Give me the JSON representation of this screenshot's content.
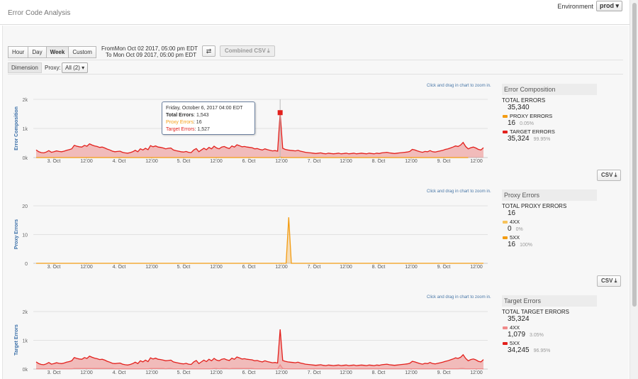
{
  "page": {
    "title": "Error Code Analysis",
    "environment_label": "Environment",
    "environment_value": "prod"
  },
  "toolbar": {
    "ranges": [
      "Hour",
      "Day",
      "Week",
      "Custom"
    ],
    "active_range": "Week",
    "from_label": "From",
    "from_value": "Mon Oct 02 2017, 05:00 pm EDT",
    "to_label": "To",
    "to_value": "Mon Oct 09 2017, 05:00 pm EDT",
    "swap_icon": "swap-arrows-icon",
    "combined_csv_label": "Combined CSV",
    "download_icon": "download-icon"
  },
  "dimension": {
    "label": "Dimension",
    "proxy_label": "Proxy:",
    "proxy_value": "All (2)"
  },
  "zoom_hint": "Click and drag in chart to zoom in.",
  "csv_label": "CSV",
  "tooltip": {
    "date": "Friday, October 6, 2017 04:00 EDT",
    "total_label": "Total Errors",
    "total_value": "1,543",
    "proxy_label": "Proxy Errors",
    "proxy_value": "16",
    "target_label": "Target Errors",
    "target_value": "1,527"
  },
  "legends": {
    "composition": {
      "title": "Error Composition",
      "total_label": "TOTAL ERRORS",
      "total_value": "35,340",
      "rows": [
        {
          "label": "PROXY ERRORS",
          "value": "16",
          "pct": "0.05%",
          "color": "#f39c12"
        },
        {
          "label": "TARGET ERRORS",
          "value": "35,324",
          "pct": "99.95%",
          "color": "#e3201c"
        }
      ]
    },
    "proxy": {
      "title": "Proxy Errors",
      "total_label": "TOTAL PROXY ERRORS",
      "total_value": "16",
      "rows": [
        {
          "label": "4XX",
          "value": "0",
          "pct": "0%",
          "color": "#f7c35a"
        },
        {
          "label": "5XX",
          "value": "16",
          "pct": "100%",
          "color": "#f39c12"
        }
      ]
    },
    "target": {
      "title": "Target Errors",
      "total_label": "TOTAL TARGET ERRORS",
      "total_value": "35,324",
      "rows": [
        {
          "label": "4XX",
          "value": "1,079",
          "pct": "3.05%",
          "color": "#f08a8a"
        },
        {
          "label": "5XX",
          "value": "34,245",
          "pct": "96.95%",
          "color": "#e3201c"
        }
      ]
    }
  },
  "chart_data": [
    {
      "type": "area",
      "title": "",
      "ylabel": "Error Composition",
      "x_ticks": [
        "3. Oct",
        "12:00",
        "4. Oct",
        "12:00",
        "5. Oct",
        "12:00",
        "6. Oct",
        "12:00",
        "7. Oct",
        "12:00",
        "8. Oct",
        "12:00",
        "9. Oct",
        "12:00"
      ],
      "y_ticks": [
        "0k",
        "1k",
        "2k"
      ],
      "ylim": [
        0,
        2000
      ],
      "x_start": "2017-10-02 17:00",
      "x_end": "2017-10-09 17:00",
      "interval_hours": 1,
      "series": [
        {
          "name": "Target Errors",
          "color": "#e3201c",
          "values": [
            260,
            200,
            170,
            160,
            190,
            240,
            180,
            200,
            230,
            210,
            200,
            220,
            250,
            270,
            300,
            420,
            390,
            370,
            360,
            420,
            390,
            470,
            430,
            400,
            380,
            350,
            360,
            330,
            290,
            260,
            220,
            200,
            210,
            220,
            180,
            160,
            150,
            170,
            200,
            250,
            200,
            300,
            260,
            320,
            270,
            410,
            370,
            400,
            360,
            350,
            330,
            300,
            320,
            330,
            260,
            240,
            220,
            200,
            190,
            210,
            180,
            170,
            260,
            310,
            200,
            260,
            320,
            270,
            350,
            300,
            390,
            330,
            300,
            360,
            380,
            340,
            310,
            400,
            360,
            440,
            410,
            370,
            380,
            360,
            350,
            340,
            300,
            310,
            280,
            260,
            300,
            270,
            250,
            230,
            240,
            220,
            1527,
            320,
            280,
            260,
            250,
            240,
            230,
            250,
            220,
            200,
            180,
            170,
            160,
            150,
            140,
            150,
            160,
            140,
            130,
            150,
            140,
            130,
            140,
            150,
            130,
            140,
            150,
            130,
            140,
            150,
            130,
            140,
            150,
            140,
            130,
            150,
            140,
            130,
            150,
            140,
            160,
            170,
            180,
            160,
            150,
            140,
            150,
            160,
            170,
            180,
            190,
            210,
            280,
            260,
            230,
            200,
            180,
            210,
            200,
            240,
            200,
            190,
            210,
            230,
            250,
            280,
            300,
            330,
            360,
            400,
            380,
            430,
            520,
            380,
            300,
            340,
            360,
            330,
            280,
            260,
            340
          ]
        },
        {
          "name": "Proxy Errors",
          "color": "#f39c12",
          "values": [
            0,
            0,
            0,
            0,
            0,
            0,
            0,
            0,
            0,
            0,
            0,
            0,
            0,
            0,
            0,
            0,
            0,
            0,
            0,
            0,
            0,
            0,
            0,
            0,
            0,
            0,
            0,
            0,
            0,
            0,
            0,
            0,
            0,
            0,
            0,
            0,
            0,
            0,
            0,
            0,
            0,
            0,
            0,
            0,
            0,
            0,
            0,
            0,
            0,
            0,
            0,
            0,
            0,
            0,
            0,
            0,
            0,
            0,
            0,
            0,
            0,
            0,
            0,
            0,
            0,
            0,
            0,
            0,
            0,
            0,
            0,
            0,
            0,
            0,
            0,
            0,
            0,
            0,
            0,
            0,
            0,
            0,
            0,
            0,
            0,
            0,
            0,
            0,
            0,
            0,
            0,
            0,
            0,
            0,
            0,
            0,
            16,
            0,
            0,
            0,
            0,
            0,
            0,
            0,
            0,
            0,
            0,
            0,
            0,
            0,
            0,
            0,
            0,
            0,
            0,
            0,
            0,
            0,
            0,
            0,
            0,
            0,
            0,
            0,
            0,
            0,
            0,
            0,
            0,
            0,
            0,
            0,
            0,
            0,
            0,
            0,
            0,
            0,
            0,
            0,
            0,
            0,
            0,
            0,
            0,
            0,
            0,
            0,
            0,
            0,
            0,
            0,
            0,
            0,
            0,
            0,
            0,
            0,
            0,
            0,
            0,
            0,
            0,
            0,
            0,
            0,
            0,
            0,
            0,
            0,
            0
          ]
        }
      ]
    },
    {
      "type": "area",
      "title": "",
      "ylabel": "Proxy Errors",
      "x_ticks": [
        "3. Oct",
        "12:00",
        "4. Oct",
        "12:00",
        "5. Oct",
        "12:00",
        "6. Oct",
        "12:00",
        "7. Oct",
        "12:00",
        "8. Oct",
        "12:00",
        "9. Oct",
        "12:00"
      ],
      "y_ticks": [
        "0",
        "10",
        "20"
      ],
      "ylim": [
        0,
        20
      ],
      "series": [
        {
          "name": "5XX",
          "color": "#f39c12",
          "values": [
            0,
            0,
            0,
            0,
            0,
            0,
            0,
            0,
            0,
            0,
            0,
            0,
            0,
            0,
            0,
            0,
            0,
            0,
            0,
            0,
            0,
            0,
            0,
            0,
            0,
            0,
            0,
            0,
            0,
            0,
            0,
            0,
            0,
            0,
            0,
            0,
            0,
            0,
            0,
            0,
            0,
            0,
            0,
            0,
            0,
            0,
            0,
            0,
            0,
            0,
            0,
            0,
            0,
            0,
            0,
            0,
            0,
            0,
            0,
            0,
            0,
            0,
            0,
            0,
            0,
            0,
            0,
            0,
            0,
            0,
            0,
            0,
            0,
            0,
            0,
            0,
            0,
            0,
            0,
            0,
            0,
            0,
            0,
            0,
            0,
            0,
            0,
            0,
            0,
            0,
            0,
            0,
            0,
            0,
            0,
            0,
            16,
            0,
            0,
            0,
            0,
            0,
            0,
            0,
            0,
            0,
            0,
            0,
            0,
            0,
            0,
            0,
            0,
            0,
            0,
            0,
            0,
            0,
            0,
            0,
            0,
            0,
            0,
            0,
            0,
            0,
            0,
            0,
            0,
            0,
            0,
            0,
            0,
            0,
            0,
            0,
            0,
            0,
            0,
            0,
            0,
            0,
            0,
            0,
            0,
            0,
            0,
            0,
            0,
            0,
            0,
            0,
            0,
            0,
            0,
            0,
            0,
            0,
            0,
            0,
            0,
            0,
            0,
            0,
            0,
            0,
            0,
            0,
            0,
            0,
            0
          ]
        }
      ]
    },
    {
      "type": "area",
      "title": "",
      "ylabel": "Target Errors",
      "x_ticks": [
        "3. Oct",
        "12:00",
        "4. Oct",
        "12:00",
        "5. Oct",
        "12:00",
        "6. Oct",
        "12:00",
        "7. Oct",
        "12:00",
        "8. Oct",
        "12:00",
        "9. Oct",
        "12:00"
      ],
      "y_ticks": [
        "0k",
        "1k",
        "2k"
      ],
      "ylim": [
        0,
        2000
      ],
      "series": [
        {
          "name": "5XX",
          "color": "#e3201c",
          "values": [
            250,
            190,
            160,
            150,
            180,
            230,
            170,
            190,
            220,
            200,
            190,
            210,
            240,
            260,
            290,
            400,
            370,
            350,
            340,
            400,
            370,
            450,
            410,
            380,
            360,
            330,
            340,
            310,
            270,
            240,
            200,
            190,
            200,
            210,
            170,
            150,
            140,
            160,
            190,
            240,
            190,
            290,
            250,
            310,
            260,
            390,
            350,
            380,
            340,
            330,
            310,
            290,
            300,
            310,
            250,
            230,
            210,
            190,
            180,
            200,
            170,
            160,
            250,
            300,
            190,
            250,
            310,
            260,
            340,
            290,
            370,
            310,
            290,
            340,
            360,
            320,
            300,
            380,
            340,
            420,
            390,
            350,
            360,
            340,
            330,
            320,
            290,
            300,
            270,
            250,
            290,
            260,
            240,
            220,
            230,
            210,
            1380,
            300,
            270,
            250,
            240,
            230,
            220,
            240,
            210,
            190,
            170,
            160,
            150,
            140,
            130,
            140,
            150,
            130,
            120,
            140,
            130,
            120,
            130,
            140,
            120,
            130,
            140,
            120,
            130,
            140,
            120,
            130,
            140,
            130,
            120,
            140,
            130,
            120,
            140,
            130,
            150,
            160,
            170,
            150,
            140,
            130,
            140,
            150,
            160,
            170,
            180,
            200,
            270,
            250,
            220,
            190,
            170,
            200,
            190,
            230,
            190,
            180,
            200,
            220,
            240,
            270,
            290,
            320,
            350,
            390,
            370,
            410,
            500,
            370,
            290,
            330,
            350,
            320,
            270,
            250,
            330
          ]
        },
        {
          "name": "4XX",
          "color": "#f08a8a",
          "values": [
            10,
            10,
            10,
            10,
            10,
            10,
            10,
            10,
            10,
            10,
            10,
            10,
            10,
            10,
            10,
            20,
            20,
            20,
            20,
            20,
            20,
            20,
            20,
            20,
            20,
            20,
            20,
            20,
            20,
            20,
            20,
            10,
            10,
            10,
            10,
            10,
            10,
            10,
            10,
            10,
            10,
            10,
            10,
            10,
            10,
            20,
            20,
            20,
            20,
            20,
            20,
            10,
            20,
            20,
            10,
            10,
            10,
            10,
            10,
            10,
            10,
            10,
            10,
            10,
            10,
            10,
            10,
            10,
            10,
            10,
            20,
            20,
            10,
            20,
            20,
            20,
            10,
            20,
            20,
            20,
            20,
            20,
            20,
            20,
            20,
            20,
            10,
            10,
            10,
            10,
            10,
            10,
            10,
            10,
            10,
            10,
            147,
            20,
            10,
            10,
            10,
            10,
            10,
            10,
            10,
            10,
            10,
            10,
            10,
            10,
            10,
            10,
            10,
            10,
            10,
            10,
            10,
            10,
            10,
            10,
            10,
            10,
            10,
            10,
            10,
            10,
            10,
            10,
            10,
            10,
            10,
            10,
            10,
            10,
            10,
            10,
            10,
            10,
            10,
            10,
            10,
            10,
            10,
            10,
            10,
            10,
            10,
            10,
            10,
            10,
            10,
            10,
            10,
            10,
            10,
            10,
            10,
            10,
            10,
            10,
            10,
            10,
            10,
            10,
            10,
            10,
            10,
            20,
            20,
            10,
            10,
            10,
            10,
            10,
            10,
            10,
            10
          ]
        }
      ]
    }
  ]
}
